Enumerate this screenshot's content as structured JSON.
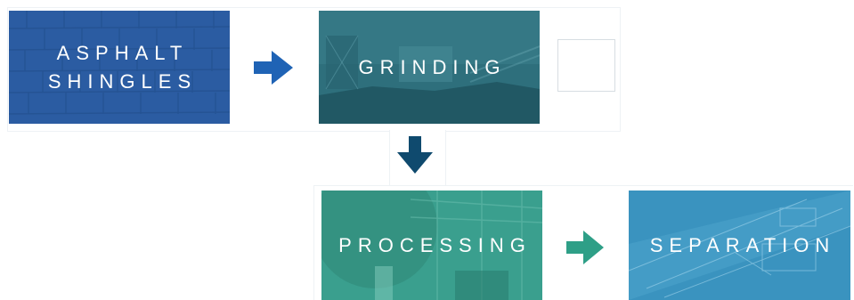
{
  "steps": {
    "shingles": {
      "label": "ASPHALT\nSHINGLES"
    },
    "grinding": {
      "label": "GRINDING"
    },
    "processing": {
      "label": "PROCESSING"
    },
    "separation": {
      "label": "SEPARATION"
    }
  },
  "colors": {
    "shingles_tile": "#2a5a9f",
    "grinding_tile": "#2e6f7c",
    "processing_tile": "#3a9f8e",
    "separation_tile": "#3a93bf",
    "arrow_blue": "#1f63b5",
    "arrow_navy": "#0f4a6e",
    "arrow_teal": "#2e9f87"
  },
  "icons": {
    "arrow_1": "arrow-right-icon",
    "arrow_2": "arrow-down-icon",
    "arrow_3": "arrow-right-icon"
  }
}
